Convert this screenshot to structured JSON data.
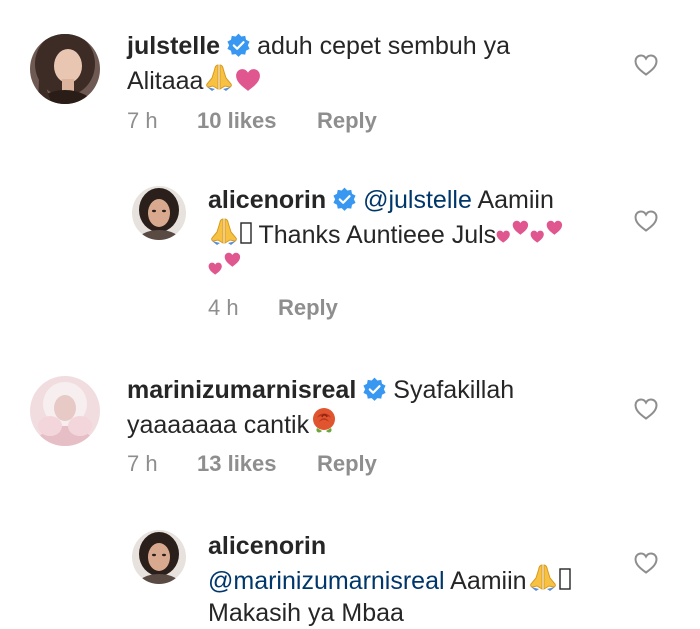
{
  "comments": [
    {
      "username": "julstelle",
      "text_1": "aduh cepet sembuh ya",
      "text_2": "Alitaaa",
      "time": "7 h",
      "likes": "10 likes",
      "reply": "Reply"
    },
    {
      "username": "alicenorin",
      "mention": "@julstelle",
      "text_1": "Aamiin",
      "text_2": "Thanks Auntieee Juls",
      "time": "4 h",
      "reply": "Reply"
    },
    {
      "username": "marinizumarnisreal",
      "text_1": "Syafakillah",
      "text_2": "yaaaaaaa cantik",
      "time": "7 h",
      "likes": "13 likes",
      "reply": "Reply"
    },
    {
      "username": "alicenorin",
      "mention": "@marinizumarnisreal",
      "text_1": "Aamiin",
      "text_2": "Makasih ya Mbaa"
    }
  ],
  "colors": {
    "text": "#262626",
    "meta": "#8e8e8e",
    "mention": "#00376b",
    "verified": "#3897f0",
    "heart_emoji": "#e0568f"
  },
  "icons": {
    "verified": "verified-badge-icon",
    "like": "heart-outline-icon",
    "pray_emoji": "folded-hands-emoji",
    "heart_emoji": "pink-heart-emoji",
    "two_hearts_emoji": "two-hearts-emoji",
    "rose_emoji": "rose-emoji"
  }
}
